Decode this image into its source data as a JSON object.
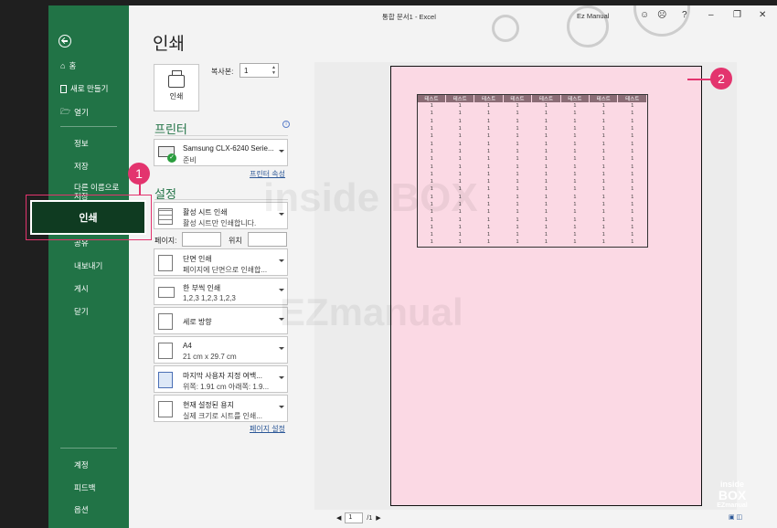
{
  "titlebar": {
    "title": "통합 문서1  -  Excel",
    "user": "Ez Manual",
    "help": "?",
    "minimize": "–",
    "restore": "❐",
    "close": "✕"
  },
  "backstage": {
    "items_top": [
      {
        "label": "홈",
        "icon": "home-icon"
      },
      {
        "label": "새로 만들기",
        "icon": "new-file-icon"
      },
      {
        "label": "열기",
        "icon": "folder-open-icon"
      }
    ],
    "items_mid": [
      "정보",
      "저장",
      "다른 이름으로 저장",
      "인쇄",
      "공유",
      "내보내기",
      "게시",
      "닫기"
    ],
    "items_bottom": [
      "계정",
      "피드백",
      "옵션"
    ]
  },
  "print": {
    "title": "인쇄",
    "button_label": "인쇄",
    "copies_label": "복사본:",
    "copies_value": "1",
    "printer_section": "프린터",
    "printer_name": "Samsung CLX-6240 Serie...",
    "printer_status": "준비",
    "printer_properties": "프린터 속성",
    "settings_section": "설정",
    "settings": [
      {
        "line1": "활성 시트 인쇄",
        "line2": "활성 시트만 인쇄합니다."
      },
      {
        "line1": "단면 인쇄",
        "line2": "페이지에 단면으로 인쇄합..."
      },
      {
        "line1": "한 부씩 인쇄",
        "line2": "1,2,3     1,2,3     1,2,3"
      },
      {
        "line1": "세로 방향",
        "line2": ""
      },
      {
        "line1": "A4",
        "line2": "21 cm x 29.7 cm"
      },
      {
        "line1": "마지막 사용자 지정 여백...",
        "line2": "위쪽: 1.91 cm 아래쪽: 1.9..."
      },
      {
        "line1": "현재 설정된 용지",
        "line2": "실제 크기로 시트를 인쇄..."
      }
    ],
    "pages_label": "페이지:",
    "to_label": "위치",
    "page_setup": "페이지 설정",
    "pager_current": "1",
    "pager_total": "/1"
  },
  "preview": {
    "headers": [
      "테스트",
      "테스트",
      "테스트",
      "테스트",
      "테스트",
      "테스트",
      "테스트",
      "테스트"
    ],
    "cell_value": "1",
    "row_count": 19,
    "page_color": "#fbd9e4"
  },
  "annotations": {
    "badge1": "1",
    "badge2": "2",
    "accent": "#e3346e"
  },
  "watermarks": [
    "inside BOX",
    "EZmanual"
  ],
  "logo": {
    "line1": "inside",
    "line2": "BOX",
    "line3": "EZmanual"
  }
}
